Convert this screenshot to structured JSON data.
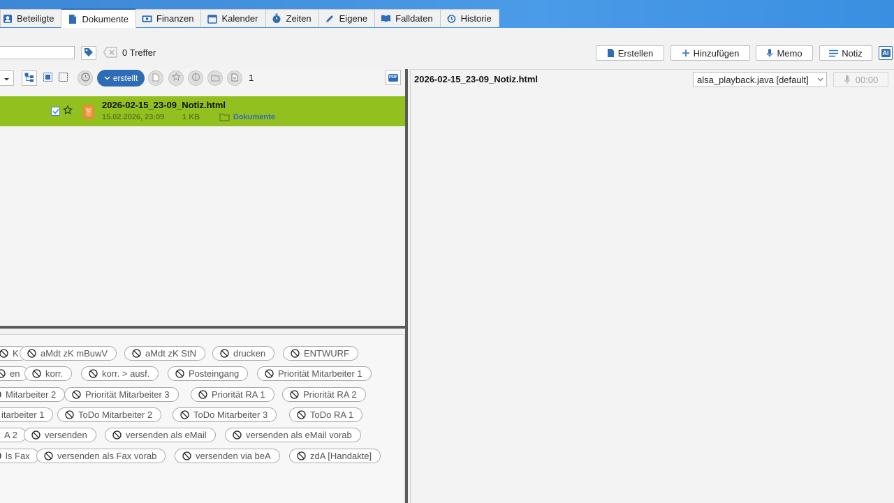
{
  "tabs": [
    {
      "label": "Beteiligte",
      "icon": "contact-card-icon",
      "active": false
    },
    {
      "label": "Dokumente",
      "icon": "document-icon",
      "active": true
    },
    {
      "label": "Finanzen",
      "icon": "money-icon",
      "active": false
    },
    {
      "label": "Kalender",
      "icon": "calendar-icon",
      "active": false
    },
    {
      "label": "Zeiten",
      "icon": "stopwatch-icon",
      "active": false
    },
    {
      "label": "Eigene",
      "icon": "pencil-icon",
      "active": false
    },
    {
      "label": "Falldaten",
      "icon": "book-icon",
      "active": false
    },
    {
      "label": "Historie",
      "icon": "history-icon",
      "active": false
    }
  ],
  "search": {
    "value": "",
    "result_count": "0 Treffer"
  },
  "toolbar": {
    "create_label": "Erstellen",
    "add_label": "Hinzufügen",
    "memo_label": "Memo",
    "note_label": "Notiz",
    "ai_label": "AI"
  },
  "filter": {
    "sort_label": "erstellt",
    "count": "1",
    "pdf_label": "PDF"
  },
  "document": {
    "name": "2026-02-15_23-09_Notiz.html",
    "date": "15.02.2026, 23:09",
    "size": "1 KB",
    "folder": "Dokumente",
    "selected_color": "#92c01f"
  },
  "preview": {
    "title": "2026-02-15_23-09_Notiz.html",
    "audio_device": "alsa_playback.java [default]",
    "record_time": "00:00"
  },
  "tags": [
    [
      "K",
      "aMdt zK mBuwV",
      "aMdt zK StN",
      "drucken",
      "ENTWURF"
    ],
    [
      "en",
      "korr.",
      "korr. > ausf.",
      "Posteingang",
      "Priorität Mitarbeiter 1"
    ],
    [
      "Mitarbeiter 2",
      "Priorität Mitarbeiter 3",
      "Priorität RA 1",
      "Priorität RA 2"
    ],
    [
      "itarbeiter 1",
      "ToDo Mitarbeiter 2",
      "ToDo Mitarbeiter 3",
      "ToDo RA 1"
    ],
    [
      "A 2",
      "versenden",
      "versenden als eMail",
      "versenden als eMail vorab"
    ],
    [
      "ls Fax",
      "versenden als Fax vorab",
      "versenden via beA",
      "zdA [Handakte]"
    ]
  ]
}
